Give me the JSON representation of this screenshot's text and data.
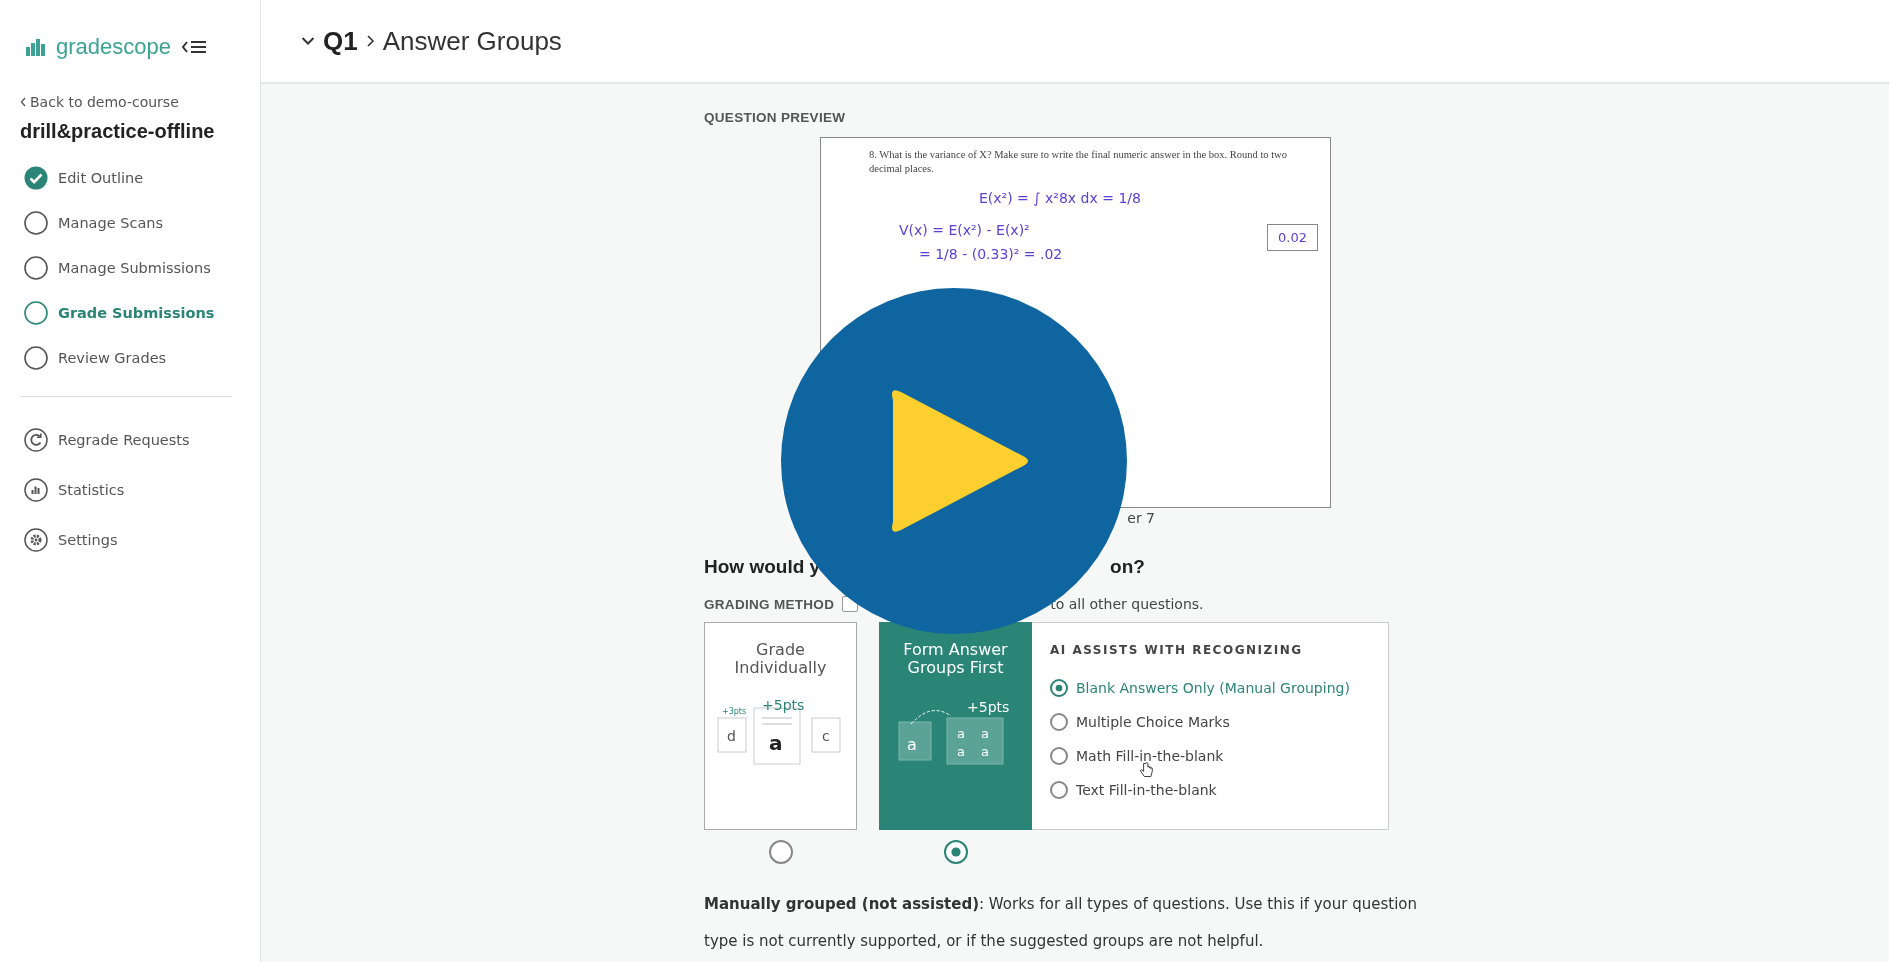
{
  "sidebar": {
    "logo": "gradescope",
    "back_link": "Back to demo-course",
    "course_title": "drill&practice-offline",
    "steps": [
      {
        "label": "Edit Outline",
        "done": true,
        "selected": false
      },
      {
        "label": "Manage Scans",
        "done": false,
        "selected": false
      },
      {
        "label": "Manage Submissions",
        "done": false,
        "selected": false
      },
      {
        "label": "Grade Submissions",
        "done": false,
        "selected": true
      },
      {
        "label": "Review Grades",
        "done": false,
        "selected": false
      }
    ],
    "tools": [
      {
        "label": "Regrade Requests",
        "kind": "regrade"
      },
      {
        "label": "Statistics",
        "kind": "statistics"
      },
      {
        "label": "Settings",
        "kind": "settings"
      }
    ]
  },
  "header": {
    "question": "Q1",
    "title": "Answer Groups"
  },
  "preview": {
    "label": "QUESTION PREVIEW",
    "prompt": "8. What is the variance of X? Make sure to write the final numeric answer in the box. Round to two decimal places.",
    "handwriting": [
      "E(x²) = ∫ x²8x dx = 1/8",
      "V(x) = E(x²) - E(x)²",
      "= 1/8 - (0.33)² = .02"
    ],
    "answer": "0.02",
    "caption_fragment": "er 7"
  },
  "method": {
    "heading_start": "How would y",
    "heading_end": "on?",
    "label": "GRADING METHOD",
    "note_fragment": "to all other questions.",
    "apply_all_checked": false,
    "cards": [
      {
        "kind": "individual",
        "title": "Grade Individually",
        "selected": false,
        "illustration": [
          "+3pts",
          "+5pts",
          "d",
          "a",
          "c"
        ]
      },
      {
        "kind": "groups",
        "title": "Form Answer Groups First",
        "selected": true,
        "illustration": [
          "+5pts",
          "a",
          "a",
          "a",
          "a",
          "a"
        ]
      }
    ],
    "assist_title": "AI ASSISTS WITH RECOGNIZING",
    "assist_options": [
      {
        "label": "Blank Answers Only (Manual Grouping)",
        "selected": true
      },
      {
        "label": "Multiple Choice Marks",
        "selected": false
      },
      {
        "label": "Math Fill-in-the-blank",
        "selected": false
      },
      {
        "label": "Text Fill-in-the-blank",
        "selected": false
      }
    ],
    "description": "**Manually grouped (not assisted)**: Works for all types of questions. Use this if your question type is not currently supported, or if the suggested groups are not helpful."
  }
}
